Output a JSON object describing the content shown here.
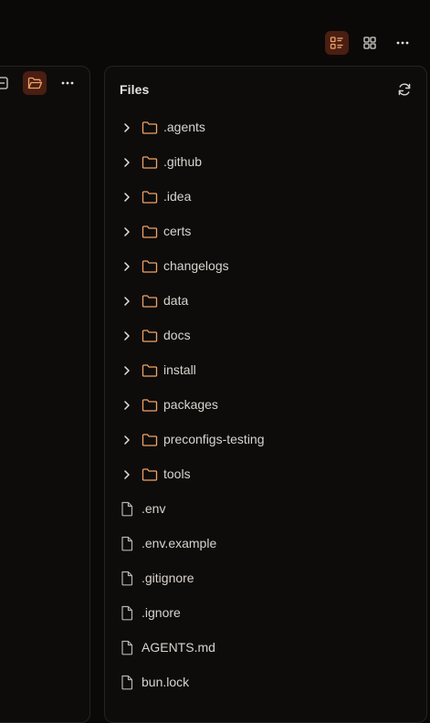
{
  "toolbar": {
    "icons": [
      "list-view-icon",
      "grid-view-icon",
      "more-icon"
    ],
    "active_color": "#4a1e12",
    "accent": "#f0a366"
  },
  "left_panel": {
    "icons": [
      "collapse-icon",
      "folder-open-icon",
      "more-icon"
    ]
  },
  "files_panel": {
    "title": "Files",
    "refresh_icon": "refresh-icon",
    "folder_color": "#f0a366",
    "items": [
      {
        "name": ".agents",
        "type": "folder"
      },
      {
        "name": ".github",
        "type": "folder"
      },
      {
        "name": ".idea",
        "type": "folder"
      },
      {
        "name": "certs",
        "type": "folder"
      },
      {
        "name": "changelogs",
        "type": "folder"
      },
      {
        "name": "data",
        "type": "folder"
      },
      {
        "name": "docs",
        "type": "folder"
      },
      {
        "name": "install",
        "type": "folder"
      },
      {
        "name": "packages",
        "type": "folder"
      },
      {
        "name": "preconfigs-testing",
        "type": "folder"
      },
      {
        "name": "tools",
        "type": "folder"
      },
      {
        "name": ".env",
        "type": "file"
      },
      {
        "name": ".env.example",
        "type": "file"
      },
      {
        "name": ".gitignore",
        "type": "file"
      },
      {
        "name": ".ignore",
        "type": "file"
      },
      {
        "name": "AGENTS.md",
        "type": "file"
      },
      {
        "name": "bun.lock",
        "type": "file"
      }
    ]
  }
}
